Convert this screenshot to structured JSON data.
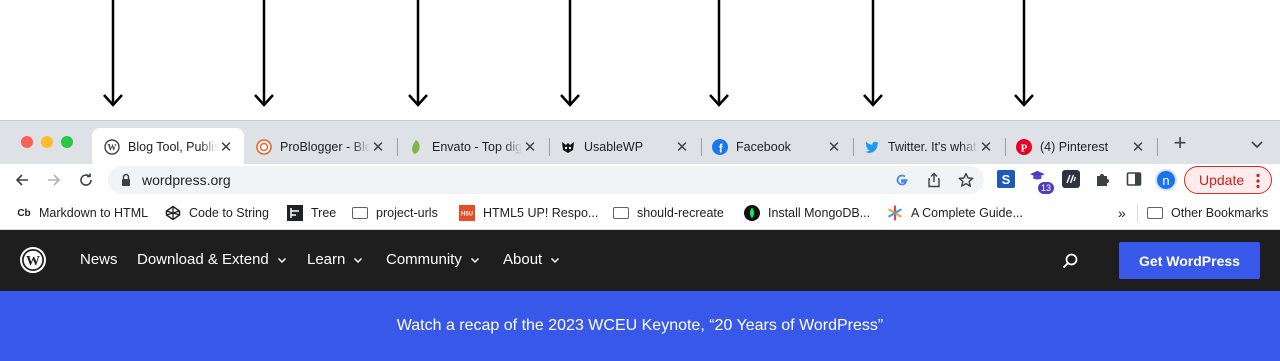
{
  "tabs": [
    {
      "title": "Blog Tool, Publishing Platform, and CMS",
      "favicon": "wordpress-icon",
      "active": true
    },
    {
      "title": "ProBlogger - Blog Tips",
      "favicon": "problogger-icon",
      "active": false
    },
    {
      "title": "Envato - Top digital assets",
      "favicon": "envato-icon",
      "active": false
    },
    {
      "title": "UsableWP",
      "favicon": "usablewp-icon",
      "active": false
    },
    {
      "title": "Facebook",
      "favicon": "facebook-icon",
      "active": false
    },
    {
      "title": "Twitter. It's what's happening",
      "favicon": "twitter-icon",
      "active": false
    },
    {
      "title": "(4) Pinterest",
      "favicon": "pinterest-icon",
      "active": false
    }
  ],
  "tab_close_glyph": "✕",
  "new_tab_glyph": "+",
  "toolbar": {
    "url": "wordpress.org",
    "extensions": [
      "s-extension-icon",
      "graduation-cap-extension-icon",
      "wappalyzer-extension-icon",
      "puzzle-icon",
      "sidebar-icon"
    ],
    "badge_count": "13",
    "profile_initial": "n",
    "update_label": "Update"
  },
  "bookmarks": [
    {
      "label": "Markdown to HTML",
      "icon": "cb-icon"
    },
    {
      "label": "Code to String",
      "icon": "codepen-icon"
    },
    {
      "label": "Tree",
      "icon": "tree-icon"
    },
    {
      "label": "project-urls",
      "icon": "folder-icon"
    },
    {
      "label": "HTML5 UP! Respo...",
      "icon": "html5up-icon"
    },
    {
      "label": "should-recreate",
      "icon": "folder-icon"
    },
    {
      "label": "Install MongoDB...",
      "icon": "mongodb-icon"
    },
    {
      "label": "A Complete Guide...",
      "icon": "asterisk-icon"
    }
  ],
  "bookmarks_overflow": "»",
  "other_bookmarks": "Other Bookmarks",
  "wp_nav": {
    "items": [
      {
        "label": "News",
        "dropdown": false
      },
      {
        "label": "Download & Extend",
        "dropdown": true
      },
      {
        "label": "Learn",
        "dropdown": true
      },
      {
        "label": "Community",
        "dropdown": true
      },
      {
        "label": "About",
        "dropdown": true
      }
    ],
    "cta": "Get WordPress"
  },
  "banner": {
    "text": "Watch a recap of the 2023 WCEU Keynote, “20 Years of WordPress”"
  },
  "colors": {
    "wp_dark": "#1e1e1e",
    "wp_blue": "#3858e9",
    "tabstrip": "#dee1e6"
  }
}
